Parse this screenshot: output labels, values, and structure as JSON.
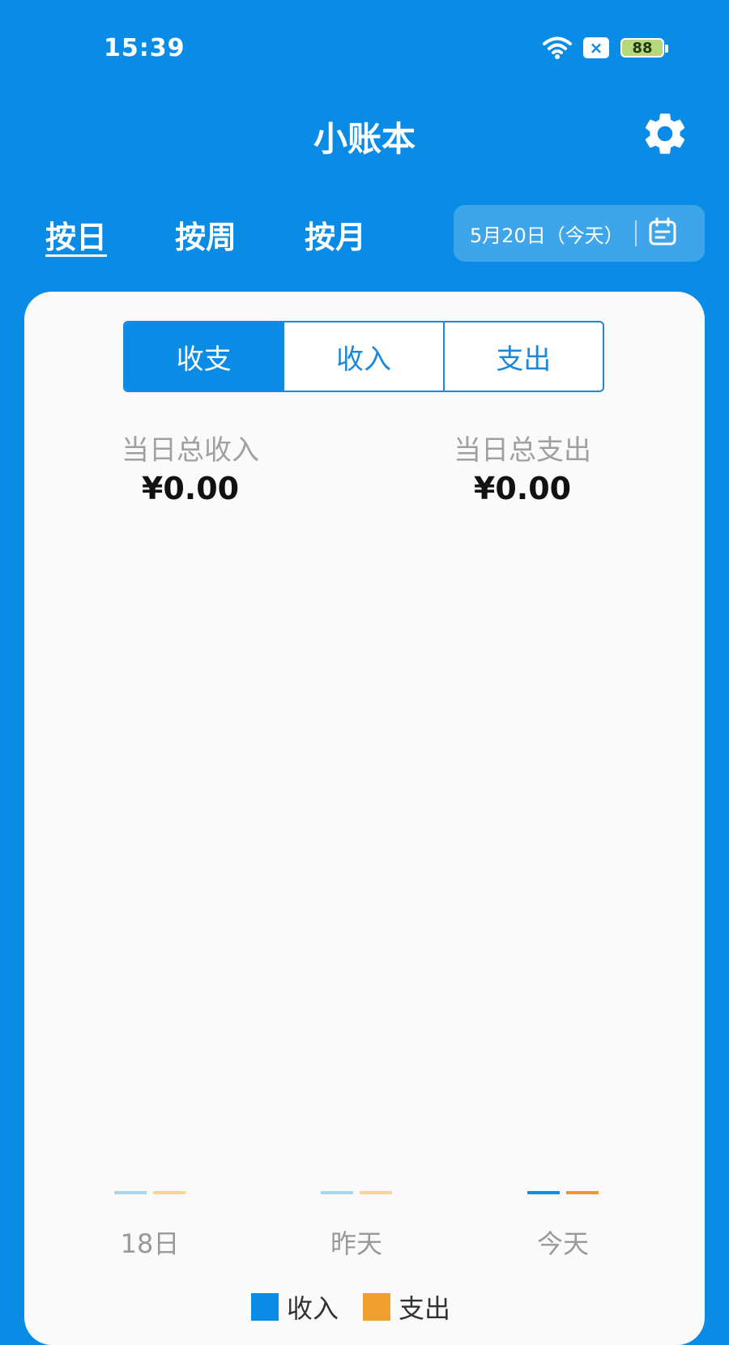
{
  "status_bar": {
    "time": "15:39",
    "battery": "88",
    "sim_icon": "sim-x-icon"
  },
  "app": {
    "title": "小账本"
  },
  "period_tabs": [
    {
      "label": "按日",
      "active": true
    },
    {
      "label": "按周",
      "active": false
    },
    {
      "label": "按月",
      "active": false
    }
  ],
  "date_picker": {
    "label": "5月20日（今天）",
    "icon": "calendar-icon"
  },
  "segment": [
    {
      "label": "收支",
      "active": true
    },
    {
      "label": "收入",
      "active": false
    },
    {
      "label": "支出",
      "active": false
    }
  ],
  "summary": {
    "income_label": "当日总收入",
    "income_value": "¥0.00",
    "expense_label": "当日总支出",
    "expense_value": "¥0.00"
  },
  "chart_data": {
    "type": "bar",
    "categories": [
      "18日",
      "昨天",
      "今天"
    ],
    "series": [
      {
        "name": "收入",
        "values": [
          0,
          0,
          0
        ]
      },
      {
        "name": "支出",
        "values": [
          0,
          0,
          0
        ]
      }
    ],
    "colors": {
      "income_faded": "#a8d4ec",
      "expense_faded": "#f6d39a",
      "income": "#1e88d8",
      "expense": "#e89a2e"
    },
    "legend_position": "bottom"
  },
  "legend": [
    {
      "label": "收入",
      "color": "#0a8ce6"
    },
    {
      "label": "支出",
      "color": "#f0a030"
    }
  ],
  "colors": {
    "primary": "#0a8ce6",
    "card_bg": "#fafafa"
  }
}
